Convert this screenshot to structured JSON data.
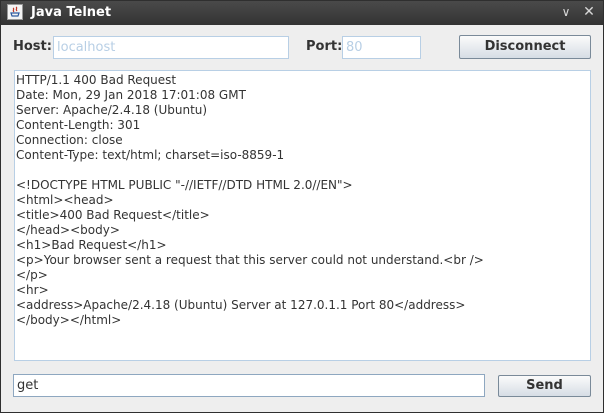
{
  "window": {
    "title": "Java Telnet"
  },
  "titlebar": {
    "min_glyph": "∨",
    "close_glyph": "✕"
  },
  "connection": {
    "host_label": "Host:",
    "host_value": "localhost",
    "port_label": "Port:",
    "port_value": "80",
    "disconnect_label": "Disconnect"
  },
  "output": {
    "lines": [
      "HTTP/1.1 400 Bad Request",
      "Date: Mon, 29 Jan 2018 17:01:08 GMT",
      "Server: Apache/2.4.18 (Ubuntu)",
      "Content-Length: 301",
      "Connection: close",
      "Content-Type: text/html; charset=iso-8859-1",
      "",
      "<!DOCTYPE HTML PUBLIC \"-//IETF//DTD HTML 2.0//EN\">",
      "<html><head>",
      "<title>400 Bad Request</title>",
      "</head><body>",
      "<h1>Bad Request</h1>",
      "<p>Your browser sent a request that this server could not understand.<br />",
      "</p>",
      "<hr>",
      "<address>Apache/2.4.18 (Ubuntu) Server at 127.0.1.1 Port 80</address>",
      "</body></html>"
    ]
  },
  "command": {
    "input_value": "get",
    "send_label": "Send"
  },
  "colors": {
    "titlebar": "#3c3c3c",
    "field_border": "#b8cfe5",
    "window_bg": "#eeeeee"
  }
}
